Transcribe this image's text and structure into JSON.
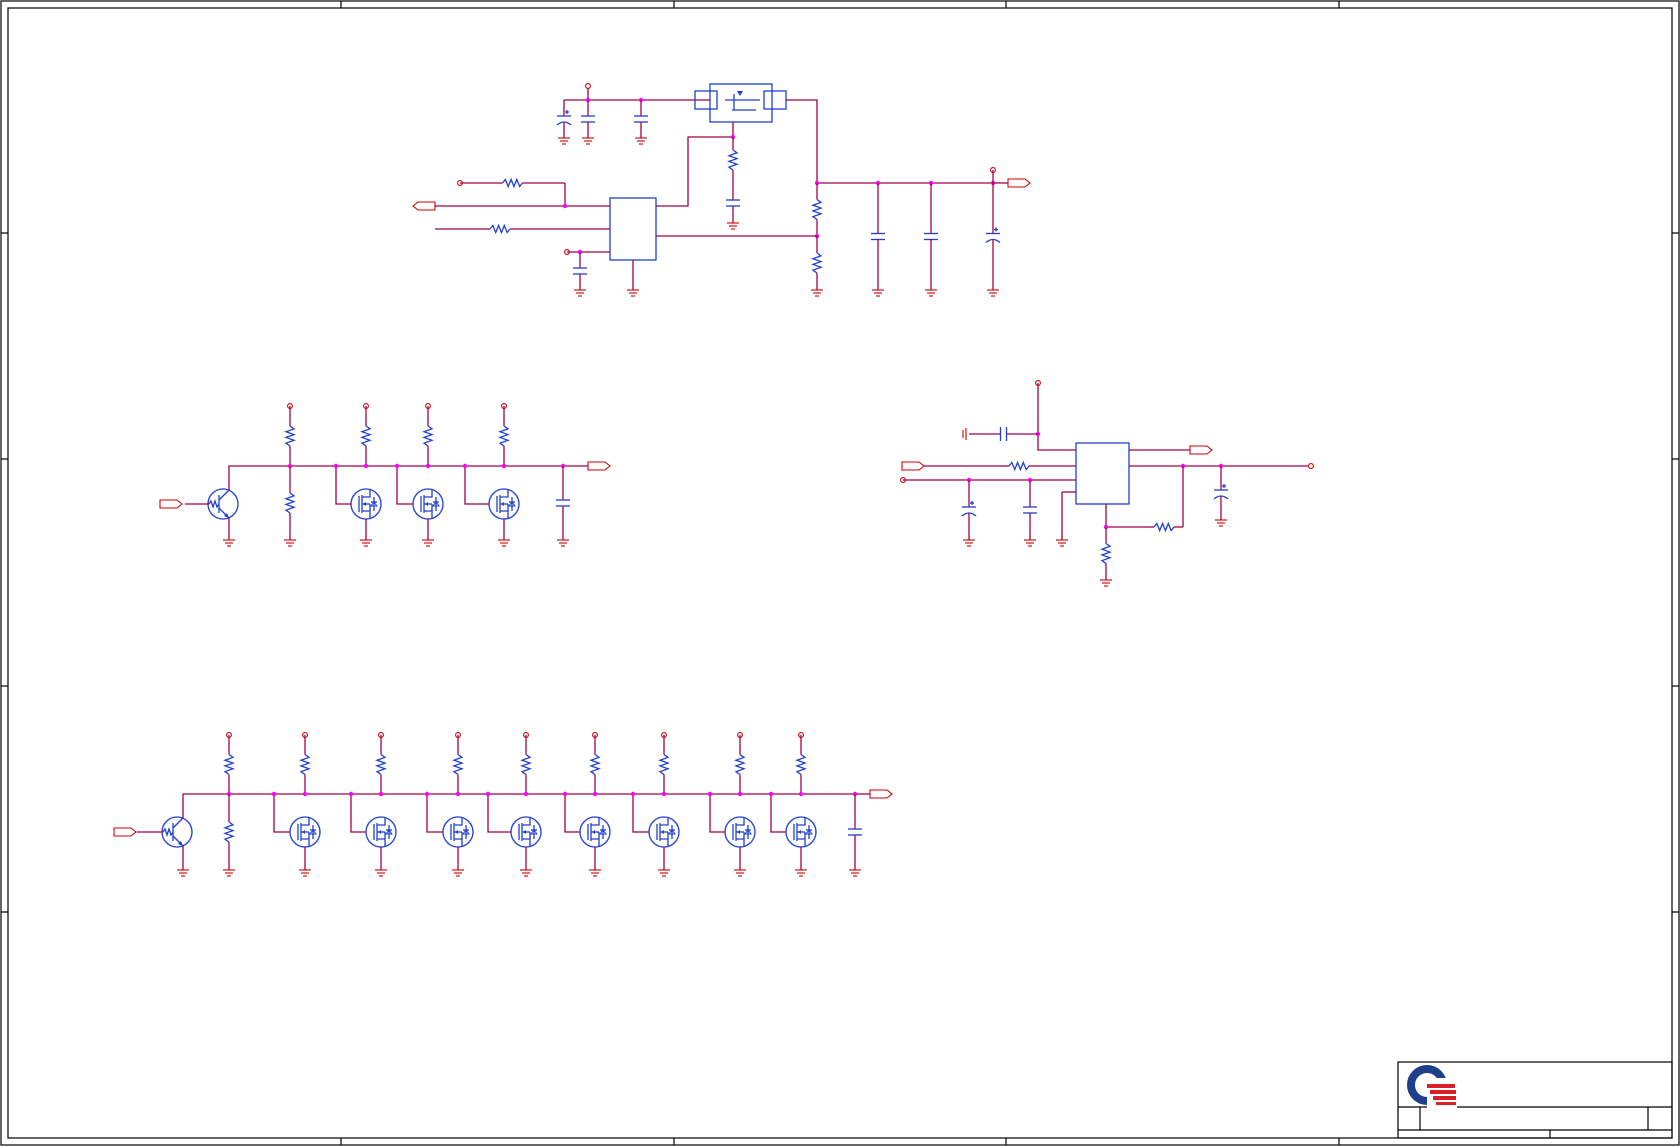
{
  "sheet": {
    "frame_color": "#000000",
    "wire_color": "#a0004a",
    "component_color": "#1f3fd0",
    "power_symbol_color": "#cc0000",
    "junction_color": "#ff00ff"
  },
  "title_block": {
    "logo": "company-logo",
    "logo_colors": [
      "#1e3f8a",
      "#d8202a"
    ]
  }
}
